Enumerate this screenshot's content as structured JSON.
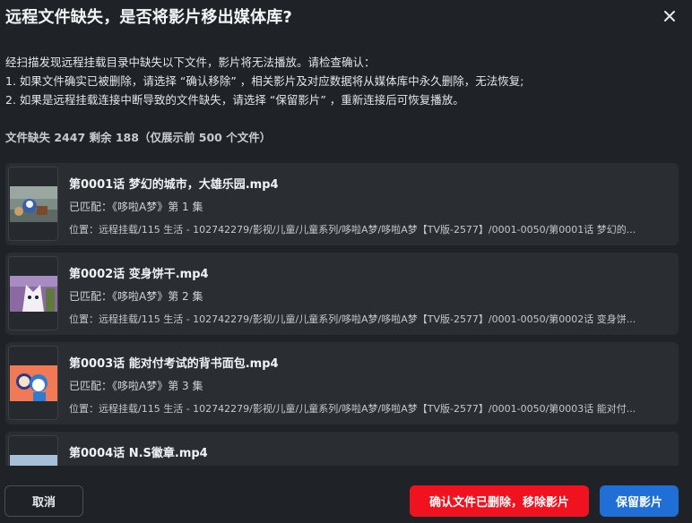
{
  "dialog": {
    "title": "远程文件缺失，是否将影片移出媒体库?",
    "description": [
      "经扫描发现远程挂载目录中缺失以下文件，影片将无法播放。请检查确认：",
      "1. 如果文件确实已被删除，请选择 “确认移除” ，相关影片及对应数据将从媒体库中永久删除，无法恢复;",
      "2. 如果是远程挂载连接中断导致的文件缺失，请选择 “保留影片” ，重新连接后可恢复播放。"
    ],
    "summary": "文件缺失 2447 剩余 188（仅展示前 500 个文件）"
  },
  "files": [
    {
      "name": "第0001话 梦幻的城市，大雄乐园.mp4",
      "matched": "已匹配：《哆啦A梦》第 1 集",
      "path": "位置：远程挂载/115 生活 - 102742279/影视/儿童/儿童系列/哆啦A梦/哆啦A梦【TV版-2577】/0001-0050/第0001话 梦幻的...",
      "thumb_icon": "scene-thumbnail-icon"
    },
    {
      "name": "第0002话 变身饼干.mp4",
      "matched": "已匹配：《哆啦A梦》第 2 集",
      "path": "位置：远程挂载/115 生活 - 102742279/影视/儿童/儿童系列/哆啦A梦/哆啦A梦【TV版-2577】/0001-0050/第0002话 变身饼...",
      "thumb_icon": "scene-thumbnail-icon"
    },
    {
      "name": "第0003话 能对付考试的背书面包.mp4",
      "matched": "已匹配：《哆啦A梦》第 3 集",
      "path": "位置：远程挂载/115 生活 - 102742279/影视/儿童/儿童系列/哆啦A梦/哆啦A梦【TV版-2577】/0001-0050/第0003话 能对付...",
      "thumb_icon": "scene-thumbnail-icon"
    },
    {
      "name": "第0004话 N.S徽章.mp4",
      "matched": "",
      "path": "",
      "thumb_icon": "scene-thumbnail-icon"
    }
  ],
  "buttons": {
    "cancel": "取消",
    "remove": "确认文件已删除，移除影片",
    "keep": "保留影片"
  },
  "colors": {
    "background": "#1f2226",
    "card": "#2a2e33",
    "danger": "#f0131f",
    "primary": "#1f6fd6"
  }
}
